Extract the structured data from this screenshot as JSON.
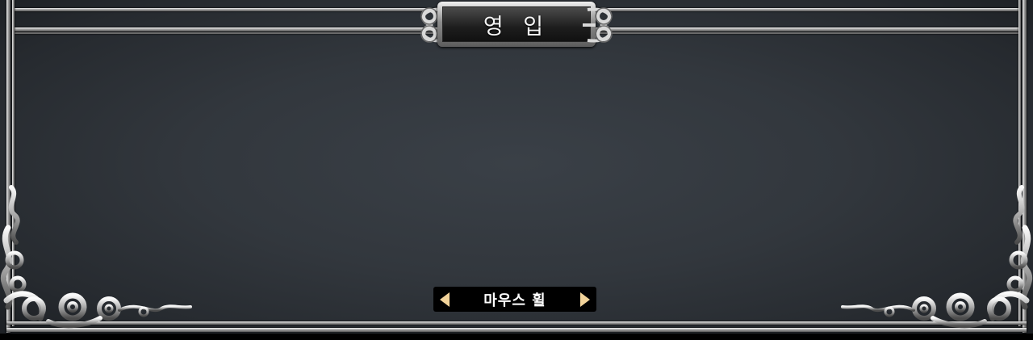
{
  "window": {
    "title": "영 입"
  },
  "navigator": {
    "label": "마우스 휠",
    "prev_icon": "arrow-left-icon",
    "next_icon": "arrow-right-icon"
  },
  "colors": {
    "background": "#32373d",
    "frame_silver": "#bdbdbd",
    "plaque_dark": "#1d1d1d",
    "arrow_gold": "#f2d39a",
    "nav_background": "#000000",
    "text": "#ffffff"
  }
}
